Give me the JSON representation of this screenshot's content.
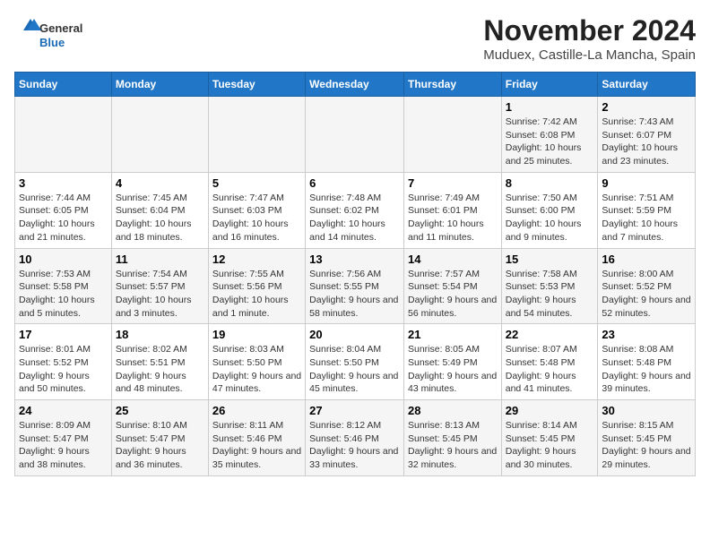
{
  "header": {
    "logo_general": "General",
    "logo_blue": "Blue",
    "month_year": "November 2024",
    "location": "Muduex, Castille-La Mancha, Spain"
  },
  "weekdays": [
    "Sunday",
    "Monday",
    "Tuesday",
    "Wednesday",
    "Thursday",
    "Friday",
    "Saturday"
  ],
  "weeks": [
    [
      {
        "day": "",
        "info": ""
      },
      {
        "day": "",
        "info": ""
      },
      {
        "day": "",
        "info": ""
      },
      {
        "day": "",
        "info": ""
      },
      {
        "day": "",
        "info": ""
      },
      {
        "day": "1",
        "info": "Sunrise: 7:42 AM\nSunset: 6:08 PM\nDaylight: 10 hours and 25 minutes."
      },
      {
        "day": "2",
        "info": "Sunrise: 7:43 AM\nSunset: 6:07 PM\nDaylight: 10 hours and 23 minutes."
      }
    ],
    [
      {
        "day": "3",
        "info": "Sunrise: 7:44 AM\nSunset: 6:05 PM\nDaylight: 10 hours and 21 minutes."
      },
      {
        "day": "4",
        "info": "Sunrise: 7:45 AM\nSunset: 6:04 PM\nDaylight: 10 hours and 18 minutes."
      },
      {
        "day": "5",
        "info": "Sunrise: 7:47 AM\nSunset: 6:03 PM\nDaylight: 10 hours and 16 minutes."
      },
      {
        "day": "6",
        "info": "Sunrise: 7:48 AM\nSunset: 6:02 PM\nDaylight: 10 hours and 14 minutes."
      },
      {
        "day": "7",
        "info": "Sunrise: 7:49 AM\nSunset: 6:01 PM\nDaylight: 10 hours and 11 minutes."
      },
      {
        "day": "8",
        "info": "Sunrise: 7:50 AM\nSunset: 6:00 PM\nDaylight: 10 hours and 9 minutes."
      },
      {
        "day": "9",
        "info": "Sunrise: 7:51 AM\nSunset: 5:59 PM\nDaylight: 10 hours and 7 minutes."
      }
    ],
    [
      {
        "day": "10",
        "info": "Sunrise: 7:53 AM\nSunset: 5:58 PM\nDaylight: 10 hours and 5 minutes."
      },
      {
        "day": "11",
        "info": "Sunrise: 7:54 AM\nSunset: 5:57 PM\nDaylight: 10 hours and 3 minutes."
      },
      {
        "day": "12",
        "info": "Sunrise: 7:55 AM\nSunset: 5:56 PM\nDaylight: 10 hours and 1 minute."
      },
      {
        "day": "13",
        "info": "Sunrise: 7:56 AM\nSunset: 5:55 PM\nDaylight: 9 hours and 58 minutes."
      },
      {
        "day": "14",
        "info": "Sunrise: 7:57 AM\nSunset: 5:54 PM\nDaylight: 9 hours and 56 minutes."
      },
      {
        "day": "15",
        "info": "Sunrise: 7:58 AM\nSunset: 5:53 PM\nDaylight: 9 hours and 54 minutes."
      },
      {
        "day": "16",
        "info": "Sunrise: 8:00 AM\nSunset: 5:52 PM\nDaylight: 9 hours and 52 minutes."
      }
    ],
    [
      {
        "day": "17",
        "info": "Sunrise: 8:01 AM\nSunset: 5:52 PM\nDaylight: 9 hours and 50 minutes."
      },
      {
        "day": "18",
        "info": "Sunrise: 8:02 AM\nSunset: 5:51 PM\nDaylight: 9 hours and 48 minutes."
      },
      {
        "day": "19",
        "info": "Sunrise: 8:03 AM\nSunset: 5:50 PM\nDaylight: 9 hours and 47 minutes."
      },
      {
        "day": "20",
        "info": "Sunrise: 8:04 AM\nSunset: 5:50 PM\nDaylight: 9 hours and 45 minutes."
      },
      {
        "day": "21",
        "info": "Sunrise: 8:05 AM\nSunset: 5:49 PM\nDaylight: 9 hours and 43 minutes."
      },
      {
        "day": "22",
        "info": "Sunrise: 8:07 AM\nSunset: 5:48 PM\nDaylight: 9 hours and 41 minutes."
      },
      {
        "day": "23",
        "info": "Sunrise: 8:08 AM\nSunset: 5:48 PM\nDaylight: 9 hours and 39 minutes."
      }
    ],
    [
      {
        "day": "24",
        "info": "Sunrise: 8:09 AM\nSunset: 5:47 PM\nDaylight: 9 hours and 38 minutes."
      },
      {
        "day": "25",
        "info": "Sunrise: 8:10 AM\nSunset: 5:47 PM\nDaylight: 9 hours and 36 minutes."
      },
      {
        "day": "26",
        "info": "Sunrise: 8:11 AM\nSunset: 5:46 PM\nDaylight: 9 hours and 35 minutes."
      },
      {
        "day": "27",
        "info": "Sunrise: 8:12 AM\nSunset: 5:46 PM\nDaylight: 9 hours and 33 minutes."
      },
      {
        "day": "28",
        "info": "Sunrise: 8:13 AM\nSunset: 5:45 PM\nDaylight: 9 hours and 32 minutes."
      },
      {
        "day": "29",
        "info": "Sunrise: 8:14 AM\nSunset: 5:45 PM\nDaylight: 9 hours and 30 minutes."
      },
      {
        "day": "30",
        "info": "Sunrise: 8:15 AM\nSunset: 5:45 PM\nDaylight: 9 hours and 29 minutes."
      }
    ]
  ]
}
